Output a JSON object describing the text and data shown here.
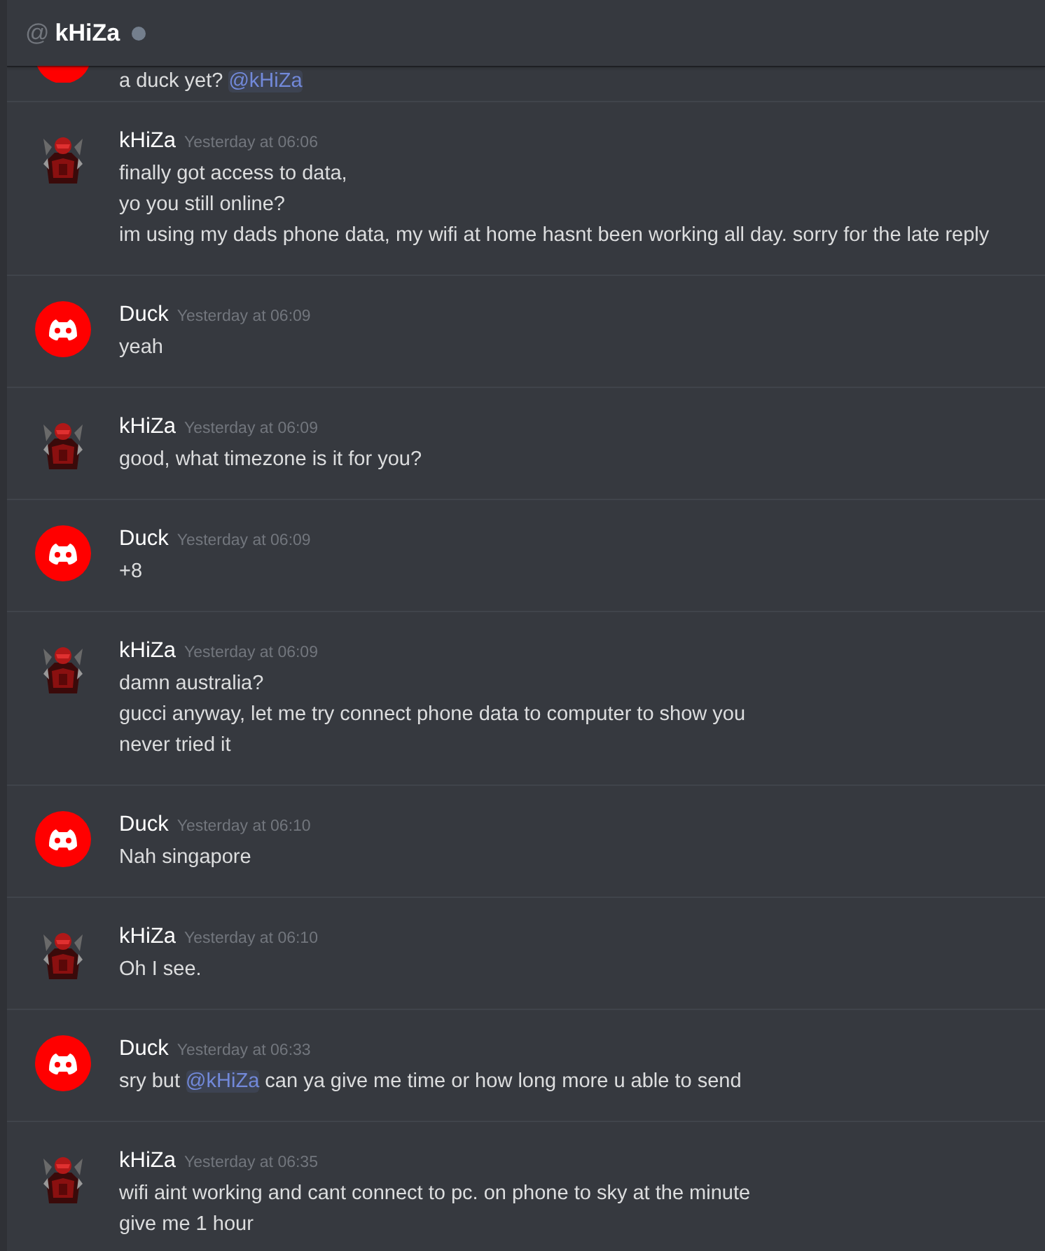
{
  "header": {
    "prefix": "@",
    "name": "kHiZa"
  },
  "messages": [
    {
      "kind": "cut",
      "lines": [
        [
          {
            "kind": "text",
            "text": "a duck yet? "
          },
          {
            "kind": "mention",
            "text": "@kHiZa"
          }
        ]
      ]
    },
    {
      "kind": "picture",
      "author": "kHiZa",
      "time": "Yesterday at 06:06",
      "lines": [
        [
          {
            "kind": "text",
            "text": "finally got access to data,"
          }
        ],
        [
          {
            "kind": "text",
            "text": "yo you still online?"
          }
        ],
        [
          {
            "kind": "text",
            "text": "im using my dads phone data, my wifi at home hasnt been working all day. sorry for the late reply"
          }
        ]
      ]
    },
    {
      "kind": "logo",
      "author": "Duck",
      "time": "Yesterday at 06:09",
      "lines": [
        [
          {
            "kind": "text",
            "text": "yeah"
          }
        ]
      ]
    },
    {
      "kind": "picture",
      "author": "kHiZa",
      "time": "Yesterday at 06:09",
      "lines": [
        [
          {
            "kind": "text",
            "text": "good, what timezone is it for you?"
          }
        ]
      ]
    },
    {
      "kind": "logo",
      "author": "Duck",
      "time": "Yesterday at 06:09",
      "lines": [
        [
          {
            "kind": "text",
            "text": "+8"
          }
        ]
      ]
    },
    {
      "kind": "picture",
      "author": "kHiZa",
      "time": "Yesterday at 06:09",
      "lines": [
        [
          {
            "kind": "text",
            "text": "damn australia?"
          }
        ],
        [
          {
            "kind": "text",
            "text": "gucci anyway, let me try connect phone data to computer to show you"
          }
        ],
        [
          {
            "kind": "text",
            "text": "never tried it"
          }
        ]
      ]
    },
    {
      "kind": "logo",
      "author": "Duck",
      "time": "Yesterday at 06:10",
      "lines": [
        [
          {
            "kind": "text",
            "text": "Nah singapore"
          }
        ]
      ]
    },
    {
      "kind": "picture",
      "author": "kHiZa",
      "time": "Yesterday at 06:10",
      "lines": [
        [
          {
            "kind": "text",
            "text": "Oh I see."
          }
        ]
      ]
    },
    {
      "kind": "logo",
      "author": "Duck",
      "time": "Yesterday at 06:33",
      "lines": [
        [
          {
            "kind": "text",
            "text": "sry but "
          },
          {
            "kind": "mention",
            "text": "@kHiZa"
          },
          {
            "kind": "text",
            "text": " can ya give me time or how long more u able to send"
          }
        ]
      ]
    },
    {
      "kind": "picture",
      "author": "kHiZa",
      "time": "Yesterday at 06:35",
      "lines": [
        [
          {
            "kind": "text",
            "text": "wifi aint working and cant connect to pc. on phone to sky at the minute"
          }
        ],
        [
          {
            "kind": "text",
            "text": "give me 1 hour"
          }
        ]
      ]
    }
  ]
}
